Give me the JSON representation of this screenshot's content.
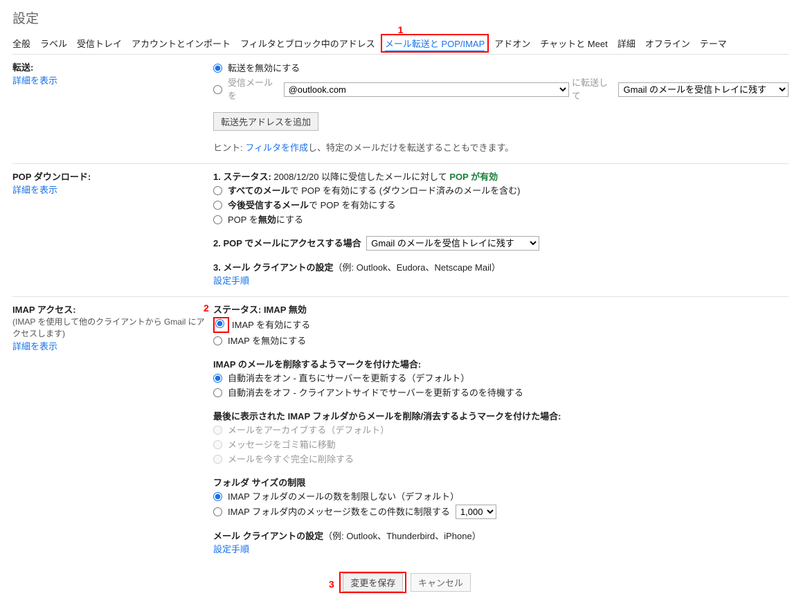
{
  "title": "設定",
  "tabs": {
    "general": "全般",
    "labels": "ラベル",
    "inbox": "受信トレイ",
    "accounts": "アカウントとインポート",
    "filters": "フィルタとブロック中のアドレス",
    "forwarding": "メール転送と POP/IMAP",
    "addons": "アドオン",
    "chat": "チャットと Meet",
    "advanced": "詳細",
    "offline": "オフライン",
    "themes": "テーマ"
  },
  "annotations": {
    "one": "1",
    "two": "2",
    "three": "3"
  },
  "forward": {
    "heading": "転送:",
    "learn": "詳細を表示",
    "disable": "転送を無効にする",
    "enable_prefix": "受信メールを",
    "address_options": [
      "                   @outlook.com"
    ],
    "enable_mid": "に転送して",
    "keep_options": [
      "Gmail のメールを受信トレイに残す"
    ],
    "add_button": "転送先アドレスを追加",
    "hint_prefix": "ヒント: ",
    "hint_link": "フィルタを作成",
    "hint_suffix": "し、特定のメールだけを転送することもできます。"
  },
  "pop": {
    "heading": "POP ダウンロード:",
    "learn": "詳細を表示",
    "status_label": "1. ステータス: ",
    "status_text_a": "2008/12/20 以降に受信したメールに対して ",
    "status_text_b": "POP が有効",
    "opt_all_a": "すべてのメール",
    "opt_all_b": "で POP を有効にする (ダウンロード済みのメールを含む)",
    "opt_now_a": "今後受信するメール",
    "opt_now_b": "で POP を有効にする",
    "opt_disable_a": "POP を",
    "opt_disable_b": "無効",
    "opt_disable_c": "にする",
    "access_label": "2. POP でメールにアクセスする場合",
    "access_options": [
      "Gmail のメールを受信トレイに残す"
    ],
    "client_label": "3. メール クライアントの設定",
    "client_examples": "（例: Outlook、Eudora、Netscape Mail）",
    "client_link": "設定手順"
  },
  "imap": {
    "heading": "IMAP アクセス:",
    "sub": "(IMAP を使用して他のクライアントから Gmail にアクセスします)",
    "learn": "詳細を表示",
    "status_label": "ステータス: IMAP 無効",
    "enable": "IMAP を有効にする",
    "disable": "IMAP を無効にする",
    "expunge_heading": "IMAP のメールを削除するようマークを付けた場合:",
    "expunge_on": "自動消去をオン - 直ちにサーバーを更新する（デフォルト）",
    "expunge_off": "自動消去をオフ - クライアントサイドでサーバーを更新するのを待機する",
    "lastfolder_heading": "最後に表示された IMAP フォルダからメールを削除/消去するようマークを付けた場合:",
    "lf_archive": "メールをアーカイブする（デフォルト）",
    "lf_trash": "メッセージをゴミ箱に移動",
    "lf_delete": "メールを今すぐ完全に削除する",
    "folder_heading": "フォルダ サイズの制限",
    "folder_nolimit": "IMAP フォルダのメールの数を制限しない（デフォルト）",
    "folder_limit": "IMAP フォルダ内のメッセージ数をこの件数に制限する",
    "folder_options": [
      "1,000"
    ],
    "client_label": "メール クライアントの設定",
    "client_examples": "（例: Outlook、Thunderbird、iPhone）",
    "client_link": "設定手順"
  },
  "buttons": {
    "save": "変更を保存",
    "cancel": "キャンセル"
  }
}
